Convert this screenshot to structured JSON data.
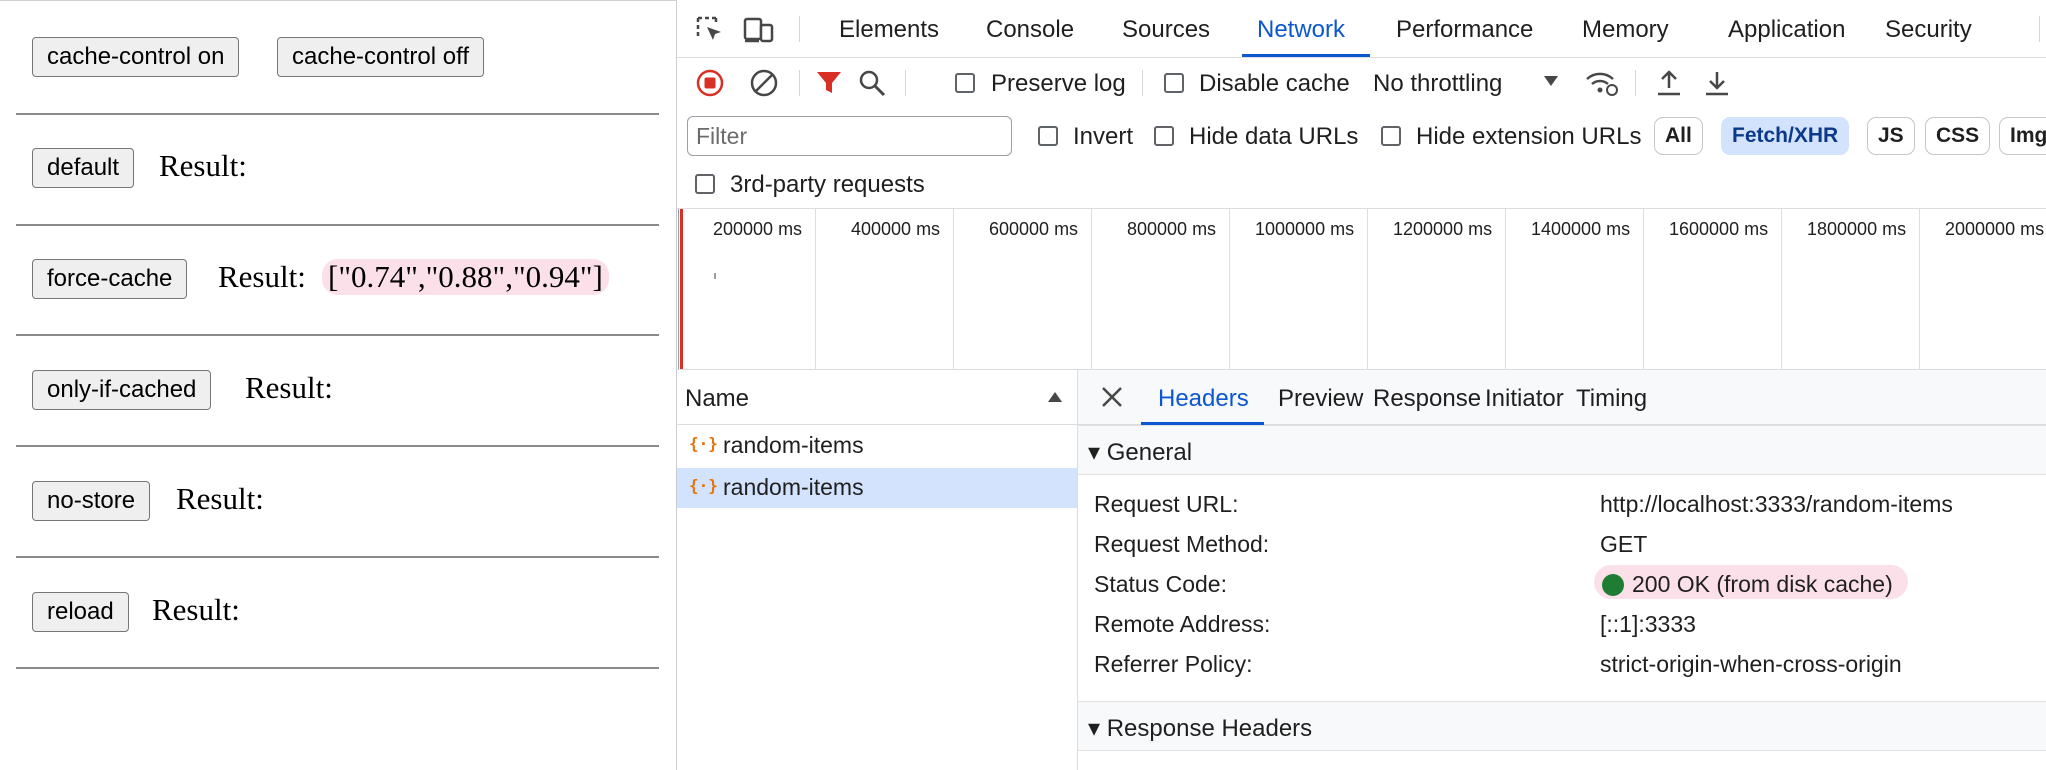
{
  "page": {
    "top_buttons": [
      "cache-control on",
      "cache-control off"
    ],
    "result_label": "Result:",
    "rows": [
      {
        "button": "default",
        "value": ""
      },
      {
        "button": "force-cache",
        "value": "[\"0.74\",\"0.88\",\"0.94\"]"
      },
      {
        "button": "only-if-cached",
        "value": ""
      },
      {
        "button": "no-store",
        "value": ""
      },
      {
        "button": "reload",
        "value": ""
      }
    ],
    "highlight_color": "#fbe0ea"
  },
  "devtools": {
    "tabs": [
      "Elements",
      "Console",
      "Sources",
      "Network",
      "Performance",
      "Memory",
      "Application",
      "Security"
    ],
    "active_tab": "Network",
    "toolbar": {
      "icons": [
        "record-stop-icon",
        "clear-icon",
        "filter-icon",
        "search-icon",
        "network-conditions-icon",
        "upload-icon",
        "download-icon"
      ],
      "preserve_log": "Preserve log",
      "disable_cache": "Disable cache",
      "throttling": "No throttling"
    },
    "filter": {
      "placeholder": "Filter",
      "invert": "Invert",
      "hide_data_urls": "Hide data URLs",
      "hide_extension_urls": "Hide extension URLs",
      "types": [
        "All",
        "Fetch/XHR",
        "JS",
        "CSS",
        "Img"
      ],
      "active_type": "Fetch/XHR",
      "third_party": "3rd-party requests"
    },
    "overview_ticks": [
      "200000 ms",
      "400000 ms",
      "600000 ms",
      "800000 ms",
      "1000000 ms",
      "1200000 ms",
      "1400000 ms",
      "1600000 ms",
      "1800000 ms",
      "2000000 ms"
    ],
    "requests": {
      "column": "Name",
      "items": [
        "random-items",
        "random-items"
      ],
      "selected_index": 1
    },
    "details": {
      "tabs": [
        "Headers",
        "Preview",
        "Response",
        "Initiator",
        "Timing"
      ],
      "active_tab": "Headers",
      "general_title": "General",
      "general": [
        {
          "key": "Request URL:",
          "value": "http://localhost:3333/random-items"
        },
        {
          "key": "Request Method:",
          "value": "GET"
        },
        {
          "key": "Status Code:",
          "value": "200 OK (from disk cache)"
        },
        {
          "key": "Remote Address:",
          "value": "[::1]:3333"
        },
        {
          "key": "Referrer Policy:",
          "value": "strict-origin-when-cross-origin"
        }
      ],
      "response_headers_title": "Response Headers"
    },
    "colors": {
      "accent": "#0b57d0",
      "selected_bg": "#d3e3fd",
      "record_red": "#d93025",
      "status_green": "#1e7d32"
    }
  }
}
